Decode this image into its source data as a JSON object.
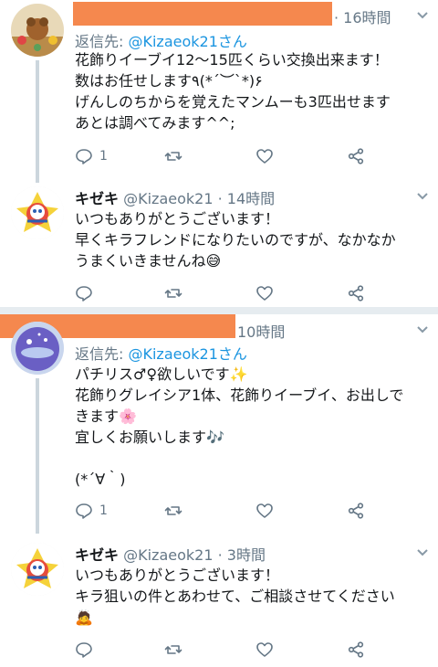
{
  "tweets": [
    {
      "handle_meta": " · 16時間",
      "reply_prefix": "返信先: ",
      "reply_to": "@Kizaeok21さん",
      "lines": [
        "花飾りイーブイ12〜15匹くらい交換出来ます！",
        "数はお任せします٩(*´︶`*)۶",
        "げんしのちからを覚えたマンムーも3匹出せます",
        "あとは調べてみます^^;"
      ],
      "reply_count": "1"
    },
    {
      "name": "キゼキ",
      "handle_meta": "@Kizaeok21 · 14時間",
      "lines": [
        "いつもありがとうございます！",
        "早くキラフレンドになりたいのですが、なかなか",
        "うまくいきませんね😅"
      ]
    },
    {
      "handle_meta": "10時間",
      "reply_prefix": "返信先: ",
      "reply_to": "@Kizaeok21さん",
      "lines": [
        "パチリス♂♀欲しいです✨",
        "花飾りグレイシア1体、花飾りイーブイ、お出しで",
        "きます🌸",
        "宜しくお願いします🎶",
        "",
        "(*´∀｀)"
      ],
      "reply_count": "1"
    },
    {
      "name": "キゼキ",
      "handle_meta": "@Kizaeok21 · 3時間",
      "lines": [
        "いつもありがとうございます！",
        "キラ狙いの件とあわせて、ご相談させてください",
        "🙇"
      ]
    }
  ],
  "icons": [
    "reply-icon",
    "retweet-icon",
    "like-icon",
    "share-icon",
    "caret-down-icon"
  ],
  "colors": {
    "text": "#14171a",
    "secondary": "#657786",
    "mention": "#1b95e0",
    "thread_line": "#ccd6dd",
    "separator": "#e6ecf0",
    "redaction": "#f5884e"
  }
}
